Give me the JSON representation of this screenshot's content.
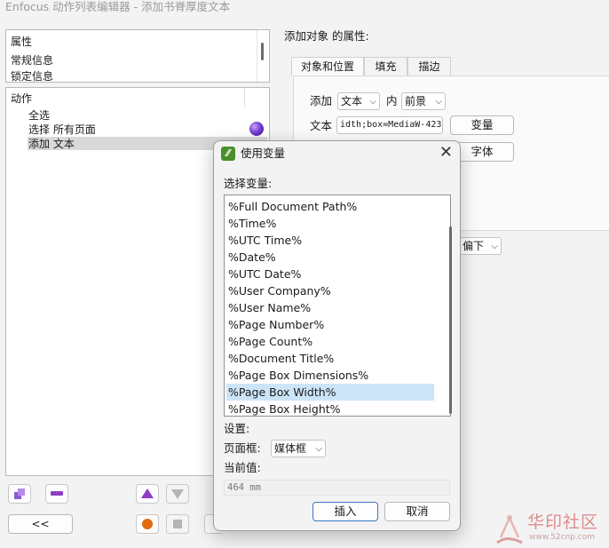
{
  "window": {
    "title": "Enfocus 动作列表编辑器 - 添加书脊厚度文本"
  },
  "properties_pane": {
    "items": [
      "属性",
      "常规信息",
      "锁定信息"
    ]
  },
  "actions_pane": {
    "header": "动作",
    "items": [
      "全选",
      "选择 所有页面",
      "添加 文本"
    ]
  },
  "bottom_left": {
    "back_button": "<<"
  },
  "right": {
    "title": "添加对象 的属性:",
    "tabs": [
      "对象和位置",
      "填充",
      "描边"
    ],
    "add_label": "添加",
    "add_type": "文本",
    "in_label": "内",
    "layer": "前景",
    "text_label": "文本",
    "text_value": "idth;box=MediaW-423",
    "variable_button": "变量",
    "font_button": "字体",
    "offset_value": "偏下"
  },
  "dialog": {
    "title": "使用变量",
    "select_label": "选择变量:",
    "variables": [
      "%Full Document Path%",
      "%Time%",
      "%UTC Time%",
      "%Date%",
      "%UTC Date%",
      "%User Company%",
      "%User Name%",
      "%Page Number%",
      "%Page Count%",
      "%Document Title%",
      "%Page Box Dimensions%",
      "%Page Box Width%",
      "%Page Box Height%"
    ],
    "selected_variable": "%Page Box Width%",
    "settings_label": "设置:",
    "page_box_label": "页面框:",
    "page_box_value": "媒体框",
    "current_value_label": "当前值:",
    "current_value": "464 mm",
    "insert_button": "插入",
    "cancel_button": "取消"
  },
  "watermark": {
    "site": "华印社区",
    "url": "www.52cnp.com"
  },
  "colors": {
    "selection": "#cce4f7",
    "dialog_icon": "#4a8f2a",
    "orb": "#7a3fd6"
  }
}
